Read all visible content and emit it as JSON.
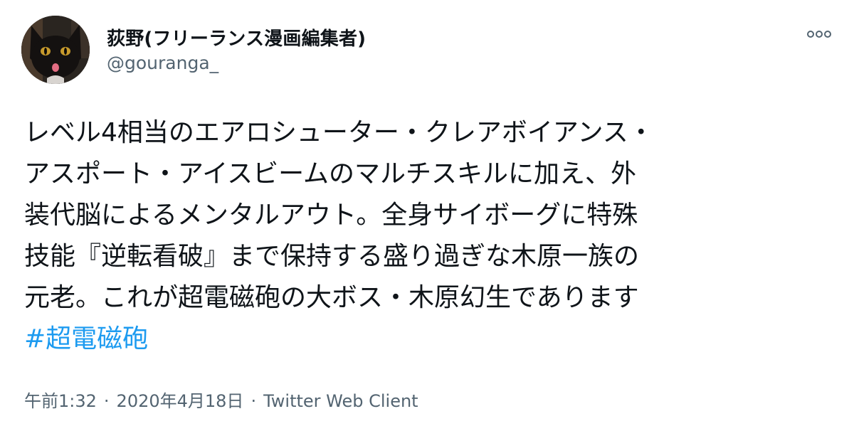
{
  "author": {
    "display_name": "荻野(フリーランス漫画編集者)",
    "handle": "@gouranga_",
    "avatar": "black-cat-avatar"
  },
  "more_icon": "more-options-icon",
  "tweet": {
    "lines": [
      "レベル4相当のエアロシューター・クレアボイアンス・",
      "アスポート・アイスビームのマルチスキルに加え、外",
      "装代脳によるメンタルアウト。全身サイボーグに特殊",
      "技能『逆転看破』まで保持する盛り過ぎな木原一族の",
      "元老。これが超電磁砲の大ボス・木原幻生であります"
    ],
    "hashtag": "#超電磁砲"
  },
  "meta": {
    "time": "午前1:32",
    "separator": "·",
    "date": "2020年4月18日",
    "client": "Twitter Web Client"
  },
  "colors": {
    "text": "#0f1419",
    "secondary": "#536471",
    "link": "#1d9bf0"
  }
}
